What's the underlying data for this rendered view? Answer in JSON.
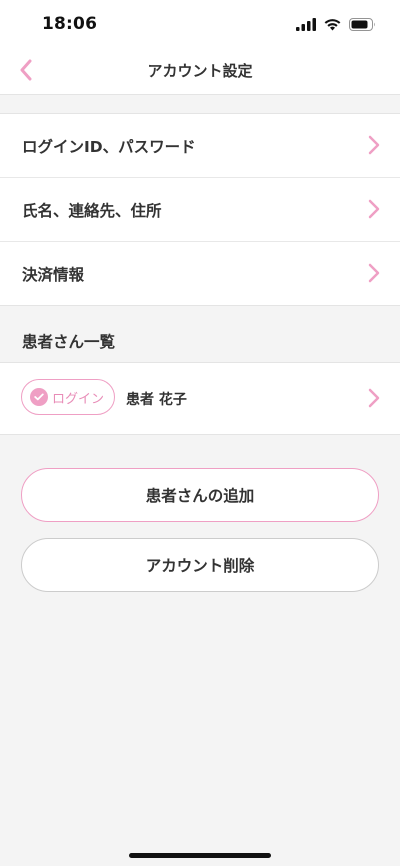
{
  "status_bar": {
    "time": "18:06"
  },
  "nav": {
    "title": "アカウント設定"
  },
  "menu": {
    "items": [
      {
        "label": "ログインID、パスワード"
      },
      {
        "label": "氏名、連絡先、住所"
      },
      {
        "label": "決済情報"
      }
    ]
  },
  "patients": {
    "header": "患者さん一覧",
    "list": [
      {
        "badge": "ログイン",
        "name": "患者 花子"
      }
    ]
  },
  "buttons": {
    "add_patient": "患者さんの追加",
    "delete_account": "アカウント削除"
  },
  "colors": {
    "accent": "#ef9fc4",
    "background": "#f4f4f4",
    "surface": "#ffffff",
    "text": "#333333"
  },
  "icons": {
    "back": "chevron-left-icon",
    "row_arrow": "chevron-right-icon",
    "login_check": "check-circle-icon"
  }
}
